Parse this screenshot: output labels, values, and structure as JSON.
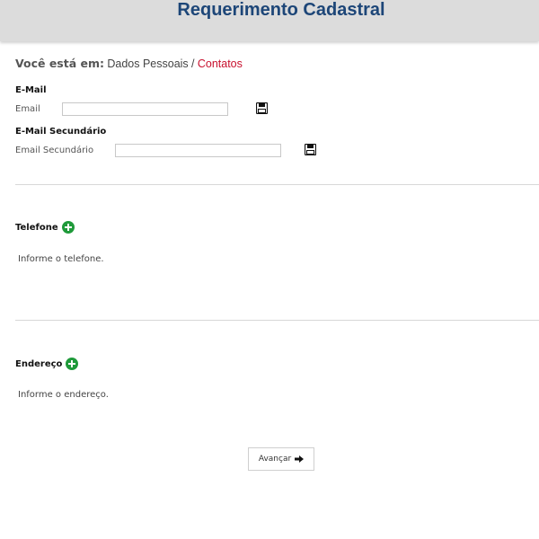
{
  "header": {
    "title": "Requerimento Cadastral"
  },
  "breadcrumb": {
    "prefix": "Você está em:",
    "item": "Dados Pessoais",
    "separator": "/",
    "current": "Contatos"
  },
  "email": {
    "heading": "E-Mail",
    "label": "Email",
    "value": "",
    "save_icon": "floppy-disk-icon"
  },
  "secondary_email": {
    "heading": "E-Mail Secundário",
    "label": "Email Secundário",
    "value": "",
    "save_icon": "floppy-disk-icon"
  },
  "phone": {
    "heading": "Telefone",
    "add_icon": "plus-circle-icon",
    "hint": "Informe o telefone."
  },
  "address": {
    "heading": "Endereço",
    "add_icon": "plus-circle-icon",
    "hint": "Informe o endereço."
  },
  "footer": {
    "next_label": "Avançar",
    "next_icon": "arrow-right-icon"
  },
  "colors": {
    "header_bg": "#dcdcdc",
    "title": "#1d4678",
    "breadcrumb_current": "#c8102e",
    "add_icon": "#1f9a3a"
  }
}
